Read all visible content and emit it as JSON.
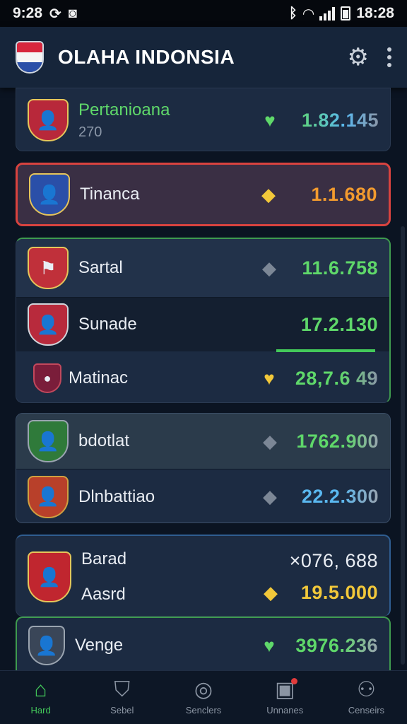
{
  "status_bar": {
    "time": "9:28",
    "clock": "18:28"
  },
  "app": {
    "title": "OLAHA INDONSIA"
  },
  "rows": [
    {
      "name": "Pertanioana",
      "sub": "270",
      "value": "1.82.145"
    },
    {
      "name": "Tinanca",
      "value": "1.1.680"
    },
    {
      "name": "Sartal",
      "value": "11.6.758"
    },
    {
      "name": "Sunade",
      "value": "17.2.130"
    },
    {
      "name": "Matinac",
      "value": "28,7.6 49"
    },
    {
      "name": "bdotlat",
      "value": "1762.900"
    },
    {
      "name": "Dlnbattiao",
      "value": "22.2.300"
    },
    {
      "name": "Barad",
      "value": "×076, 688"
    },
    {
      "name": "Aasrd",
      "value": "19.5.000"
    },
    {
      "name": "Venge",
      "value": "3976.236"
    }
  ],
  "nav": [
    {
      "label": "Hard",
      "icon": "home-icon"
    },
    {
      "label": "Sebel",
      "icon": "shield-icon"
    },
    {
      "label": "Senclers",
      "icon": "ball-icon"
    },
    {
      "label": "Unnanes",
      "icon": "message-icon"
    },
    {
      "label": "Censeirs",
      "icon": "profile-icon"
    }
  ],
  "colors": {
    "accent": "#43c95a",
    "highlight_border": "#d9433f",
    "up": "#5fd86a",
    "orange": "#f39b2e",
    "blue": "#5ab8f0",
    "gold": "#f2c83a"
  }
}
